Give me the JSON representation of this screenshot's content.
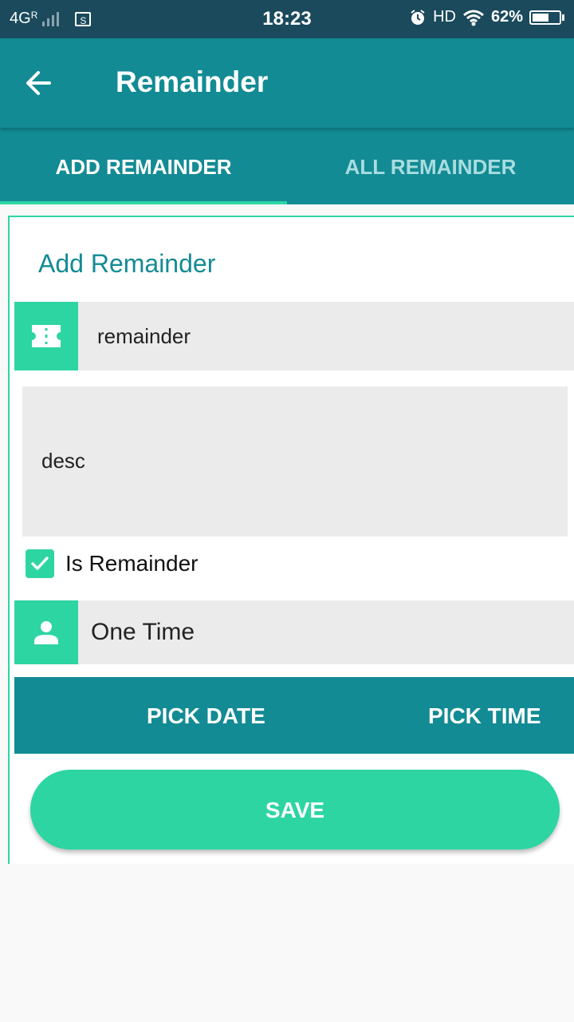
{
  "status_bar": {
    "network": "4G",
    "roaming": "R",
    "screenshot_icon_text": "S",
    "time": "18:23",
    "hd": "HD",
    "battery": "62%",
    "battery_level": 0.62
  },
  "app_bar": {
    "title": "Remainder"
  },
  "tabs": [
    {
      "label": "ADD REMAINDER",
      "active": true
    },
    {
      "label": "ALL REMAINDER",
      "active": false
    }
  ],
  "form": {
    "section_title": "Add Remainder",
    "name_value": "remainder",
    "description_value": "desc",
    "is_remainder_label": "Is Remainder",
    "is_remainder_checked": true,
    "frequency_value": "One Time",
    "pick_date_label": "PICK DATE",
    "pick_time_label": "PICK TIME",
    "save_label": "SAVE"
  },
  "colors": {
    "primary": "#138b94",
    "accent": "#2dd5a3",
    "status_bar": "#1a4a5c",
    "field_bg": "#ebebeb"
  },
  "icons": {
    "back": "arrow-left-icon",
    "name_field": "ticket-icon",
    "frequency_field": "person-icon",
    "checkbox": "check-icon"
  }
}
